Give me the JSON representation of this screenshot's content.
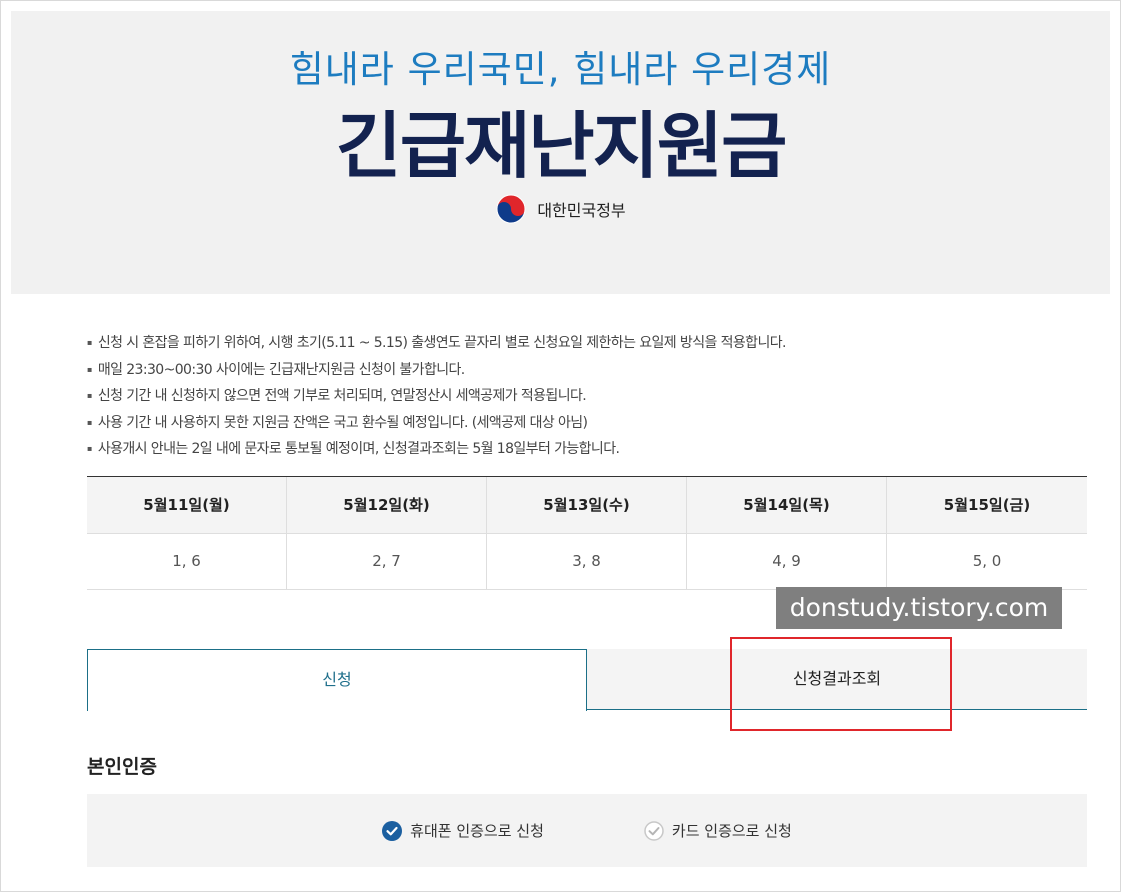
{
  "header": {
    "slogan": "힘내라 우리국민, 힘내라 우리경제",
    "title": "긴급재난지원금",
    "gov_name": "대한민국정부"
  },
  "notices": [
    "신청 시 혼잡을 피하기 위하여, 시행 초기(5.11 ~ 5.15) 출생연도 끝자리 별로 신청요일 제한하는 요일제 방식을 적용합니다.",
    "매일 23:30~00:30 사이에는 긴급재난지원금 신청이 불가합니다.",
    "신청 기간 내 신청하지 않으면 전액 기부로 처리되며, 연말정산시 세액공제가 적용됩니다.",
    "사용 기간 내 사용하지 못한 지원금 잔액은 국고 환수될 예정입니다. (세액공제 대상 아님)",
    "사용개시 안내는 2일 내에 문자로 통보될 예정이며, 신청결과조회는 5월 18일부터 가능합니다."
  ],
  "schedule": {
    "days": [
      "5월11일(월)",
      "5월12일(화)",
      "5월13일(수)",
      "5월14일(목)",
      "5월15일(금)"
    ],
    "digits": [
      "1, 6",
      "2, 7",
      "3, 8",
      "4, 9",
      "5, 0"
    ]
  },
  "watermark": "donstudy.tistory.com",
  "tabs": {
    "apply": "신청",
    "result": "신청결과조회"
  },
  "auth": {
    "title": "본인인증",
    "phone": "휴대폰 인증으로 신청",
    "card": "카드 인증으로 신청"
  },
  "colors": {
    "accent": "#1b6f87",
    "title_navy": "#13224f",
    "slogan_blue": "#1d7cc0",
    "highlight_red": "#e0262b"
  }
}
